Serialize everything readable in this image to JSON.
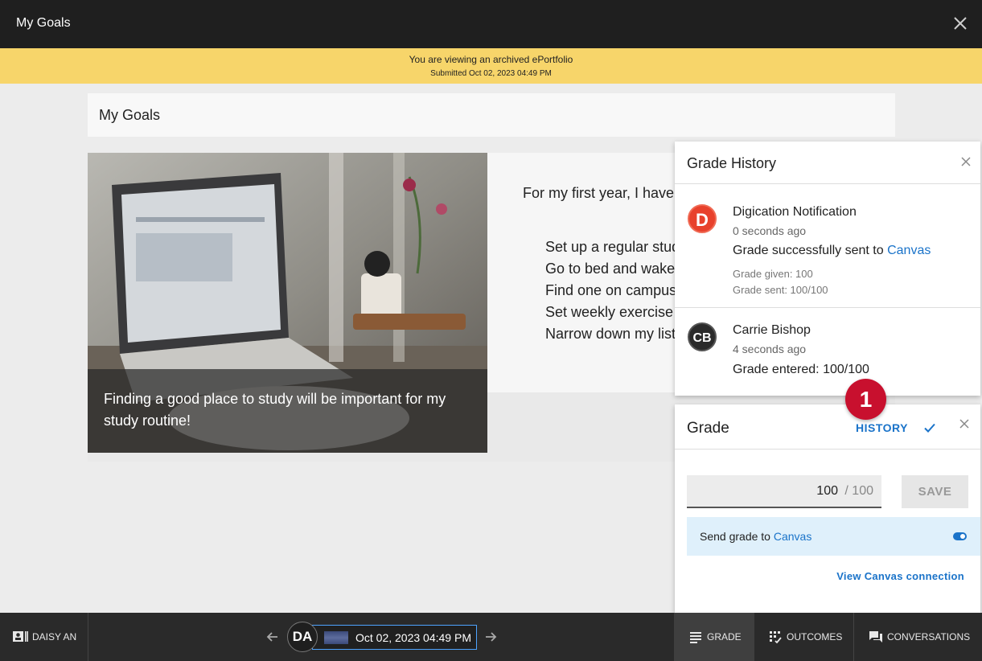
{
  "header": {
    "title": "My Goals"
  },
  "banner": {
    "line1": "You are viewing an archived ePortfolio",
    "line2": "Submitted Oct 02, 2023 04:49 PM"
  },
  "page": {
    "title": "My Goals",
    "photo_caption": "Finding a good place to study will be important for my study routine!",
    "intro": "For my first year, I have several goals I want to achieve:",
    "goals": [
      "Set up a regular study routine",
      "Go to bed and wake up at the same time",
      "Find one on campus club to join",
      "Set weekly exercise goals",
      "Narrow down my list of majors"
    ]
  },
  "grade_history": {
    "title": "Grade History",
    "entries": [
      {
        "avatar": "D",
        "name": "Digication Notification",
        "time": "0 seconds ago",
        "message_prefix": "Grade successfully sent to ",
        "message_link": "Canvas",
        "detail1": "Grade given: 100",
        "detail2": "Grade sent: 100/100"
      },
      {
        "avatar": "CB",
        "name": "Carrie Bishop",
        "time": "4 seconds ago",
        "message": "Grade entered: 100/100"
      }
    ]
  },
  "grade_panel": {
    "title": "Grade",
    "history_label": "HISTORY",
    "score_value": "100",
    "score_max": "/ 100",
    "save_label": "SAVE",
    "send_prefix": "Send grade to ",
    "send_link": "Canvas",
    "send_enabled": true,
    "view_connection": "View Canvas connection"
  },
  "callout": {
    "number": "1"
  },
  "bottom_bar": {
    "user_label": "DAISY AN",
    "avatar_initials": "DA",
    "date": "Oct 02, 2023 04:49 PM",
    "tabs": {
      "grade": "GRADE",
      "outcomes": "OUTCOMES",
      "conversations": "CONVERSATIONS"
    }
  },
  "colors": {
    "banner": "#f7d56a",
    "accent": "#1a73c9",
    "callout": "#c8102e",
    "notification_avatar": "#e8412c"
  }
}
